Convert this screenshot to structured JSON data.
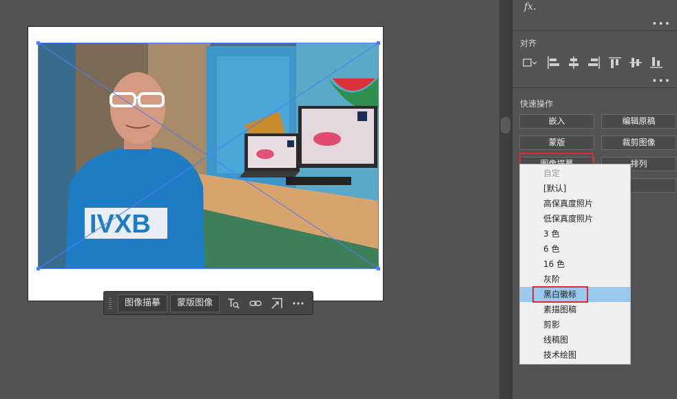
{
  "context_bar": {
    "trace_label": "图像描摹",
    "mask_label": "蒙版图像"
  },
  "panel": {
    "fx_label": "fx.",
    "align": {
      "title": "对齐"
    },
    "quick_actions": {
      "title": "快速操作",
      "embed": "嵌入",
      "edit_original": "编辑原稿",
      "mask": "蒙版",
      "crop_image": "裁剪图像",
      "image_trace": "图像描摹",
      "arrange": "排列"
    }
  },
  "trace_menu": {
    "items": [
      "自定",
      "[默认]",
      "高保真度照片",
      "低保真度照片",
      "3 色",
      "6 色",
      "16 色",
      "灰阶",
      "黑白徽标",
      "素描图稿",
      "剪影",
      "线稿图",
      "技术绘图"
    ],
    "selected": "黑白徽标"
  },
  "colors": {
    "selection_accent": "#99c9ef",
    "highlight_red": "#e0262e",
    "bbox_blue": "#4a7cff"
  }
}
